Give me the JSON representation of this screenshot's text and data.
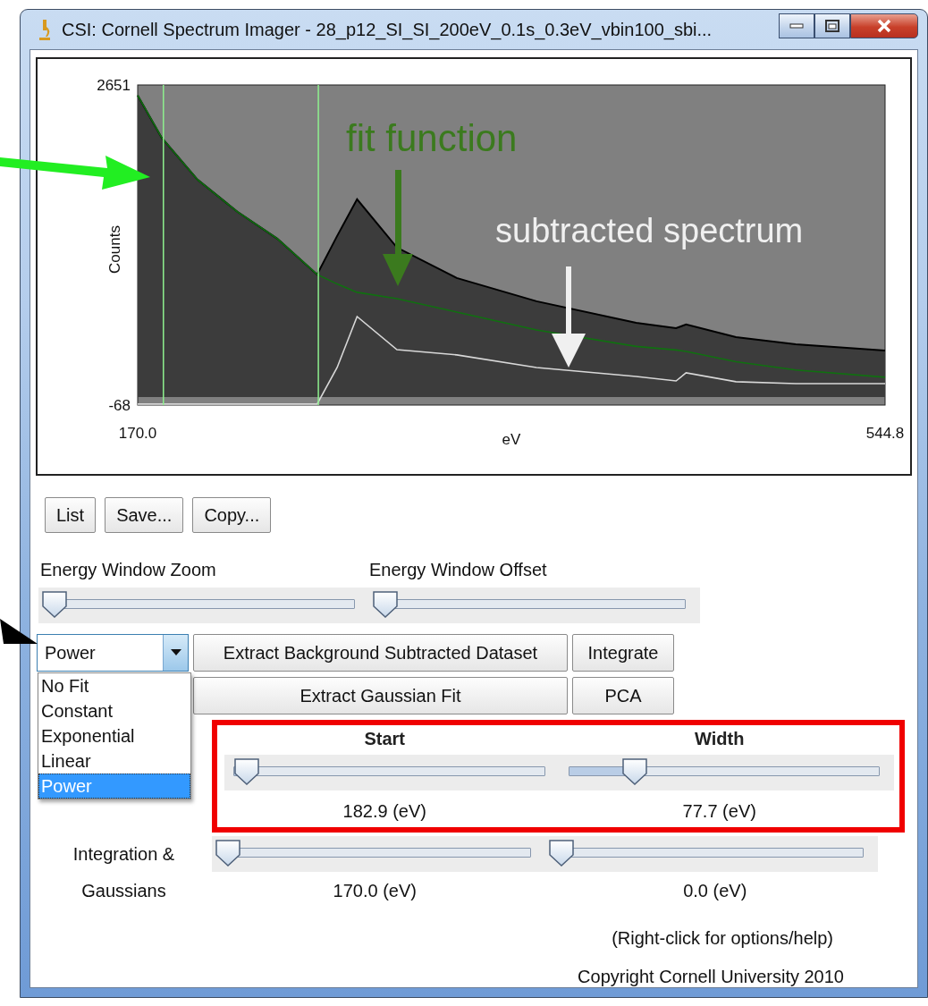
{
  "window": {
    "title": "CSI: Cornell Spectrum Imager - 28_p12_SI_SI_200eV_0.1s_0.3eV_vbin100_sbi..."
  },
  "plot": {
    "chart_data": {
      "type": "area",
      "xlabel": "eV",
      "ylabel": "Counts",
      "x": [
        170,
        182,
        200,
        220,
        240,
        260,
        270,
        280,
        300,
        330,
        370,
        420,
        440,
        445,
        470,
        500,
        544.8
      ],
      "series": [
        {
          "type": "area",
          "color": "#000000",
          "values": [
            2562,
            2204,
            1847,
            1574,
            1346,
            1042,
            1368,
            1680,
            1270,
            1011,
            814,
            631,
            586,
            616,
            510,
            449,
            396
          ]
        },
        {
          "type": "line",
          "color": "#107010",
          "values": [
            2562,
            2204,
            1847,
            1574,
            1346,
            1042,
            960,
            890,
            836,
            722,
            570,
            430,
            400,
            388,
            300,
            230,
            168
          ]
        },
        {
          "type": "line",
          "color": "#d8d8d8",
          "values": [
            -60,
            -60,
            -60,
            -60,
            -60,
            -60,
            251,
            684,
            403,
            358,
            251,
            175,
            137,
            206,
            130,
            114,
            114
          ]
        }
      ],
      "xlim": [
        170.0,
        544.8
      ],
      "ylim": [
        -68,
        2651
      ],
      "xticks": [
        {
          "value": 170,
          "label": "170.0"
        },
        {
          "value": 544.8,
          "label": "544.8"
        }
      ],
      "yticks": [
        2651,
        -68
      ],
      "ref_lines": [
        {
          "axis": "x",
          "value": 182.9
        },
        {
          "axis": "x",
          "value": 260.6
        }
      ]
    }
  },
  "callouts": [
    {
      "text": "fit function",
      "color": "#3b7a1e"
    },
    {
      "text": "subtracted spectrum",
      "color": "#f0f0f0"
    }
  ],
  "buttons": [
    "List",
    "Save...",
    "Copy..."
  ],
  "energy_window": [
    {
      "label": "Energy Window Zoom",
      "level": 0
    },
    {
      "label": "Energy Window Offset",
      "level": 0
    }
  ],
  "fit_select": {
    "value": "Power",
    "expanded": true,
    "options": [
      {
        "label": "No Fit",
        "selected": false
      },
      {
        "label": "Constant",
        "selected": false
      },
      {
        "label": "Exponential",
        "selected": false
      },
      {
        "label": "Linear",
        "selected": false
      },
      {
        "label": "Power",
        "selected": true
      }
    ]
  },
  "action_rows": [
    {
      "wide": "Extract Background Subtracted Dataset",
      "narrow": "Integrate"
    },
    {
      "wide": "Extract Gaussian Fit",
      "narrow": "PCA"
    }
  ],
  "background_window": {
    "highlighted": true,
    "sliders": [
      {
        "label": "Start",
        "level": 0.02,
        "reading": "182.9 (eV)"
      },
      {
        "label": "Width",
        "level": 0.2,
        "reading": "77.7 (eV)"
      }
    ]
  },
  "integration": {
    "label_lines": [
      "Integration &",
      "Gaussians"
    ],
    "sliders": [
      {
        "level": 0,
        "reading": "170.0 (eV)"
      },
      {
        "level": 0,
        "reading": "0.0 (eV)"
      }
    ]
  },
  "help_text": "(Right-click for options/help)",
  "copyright": "Copyright Cornell University 2010"
}
